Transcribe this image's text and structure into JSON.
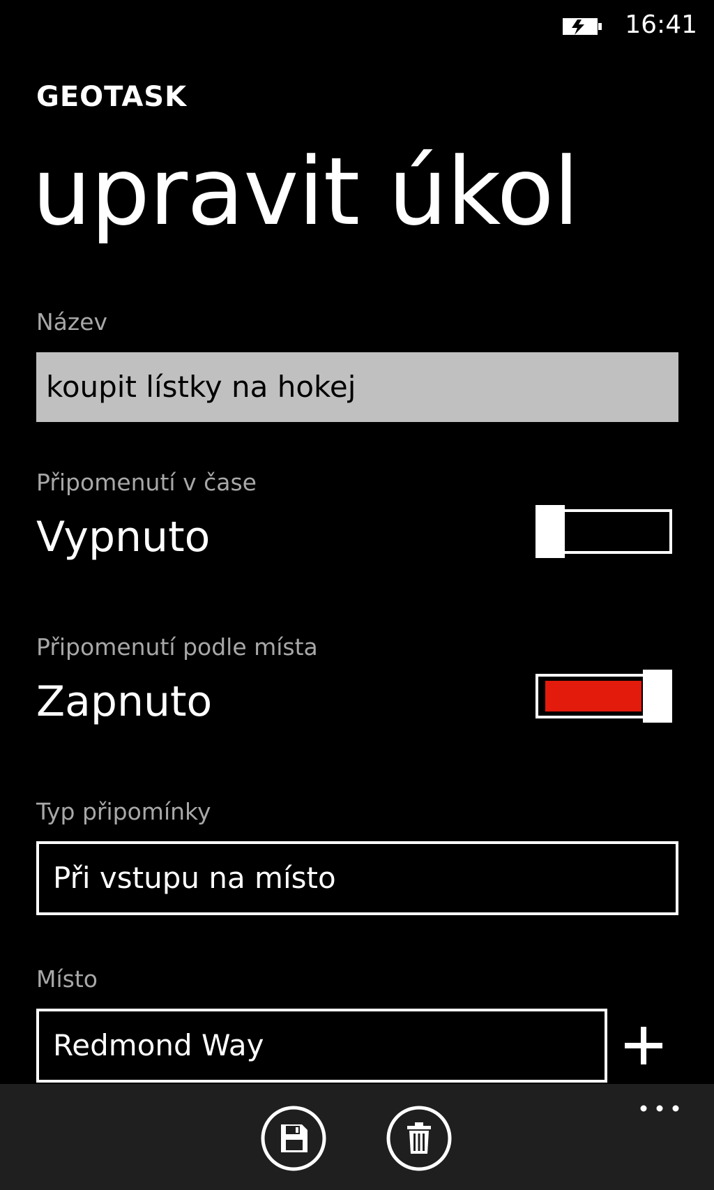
{
  "status_bar": {
    "time": "16:41",
    "battery_icon": "battery-charging-icon"
  },
  "header": {
    "app_title": "GEOTASK",
    "page_title": "upravit úkol"
  },
  "form": {
    "name": {
      "label": "Název",
      "value": "koupit lístky na hokej"
    },
    "time_reminder": {
      "label": "Připomenutí v čase",
      "state_text": "Vypnuto",
      "enabled": false
    },
    "location_reminder": {
      "label": "Připomenutí podle místa",
      "state_text": "Zapnuto",
      "enabled": true,
      "accent_color": "#e31b0c"
    },
    "reminder_type": {
      "label": "Typ připomínky",
      "value": "Při vstupu na místo"
    },
    "location": {
      "label": "Místo",
      "value": "Redmond Way",
      "add_icon": "plus-icon"
    }
  },
  "app_bar": {
    "buttons": [
      {
        "icon": "save-icon"
      },
      {
        "icon": "delete-icon"
      }
    ],
    "more_icon": "ellipsis-icon"
  }
}
